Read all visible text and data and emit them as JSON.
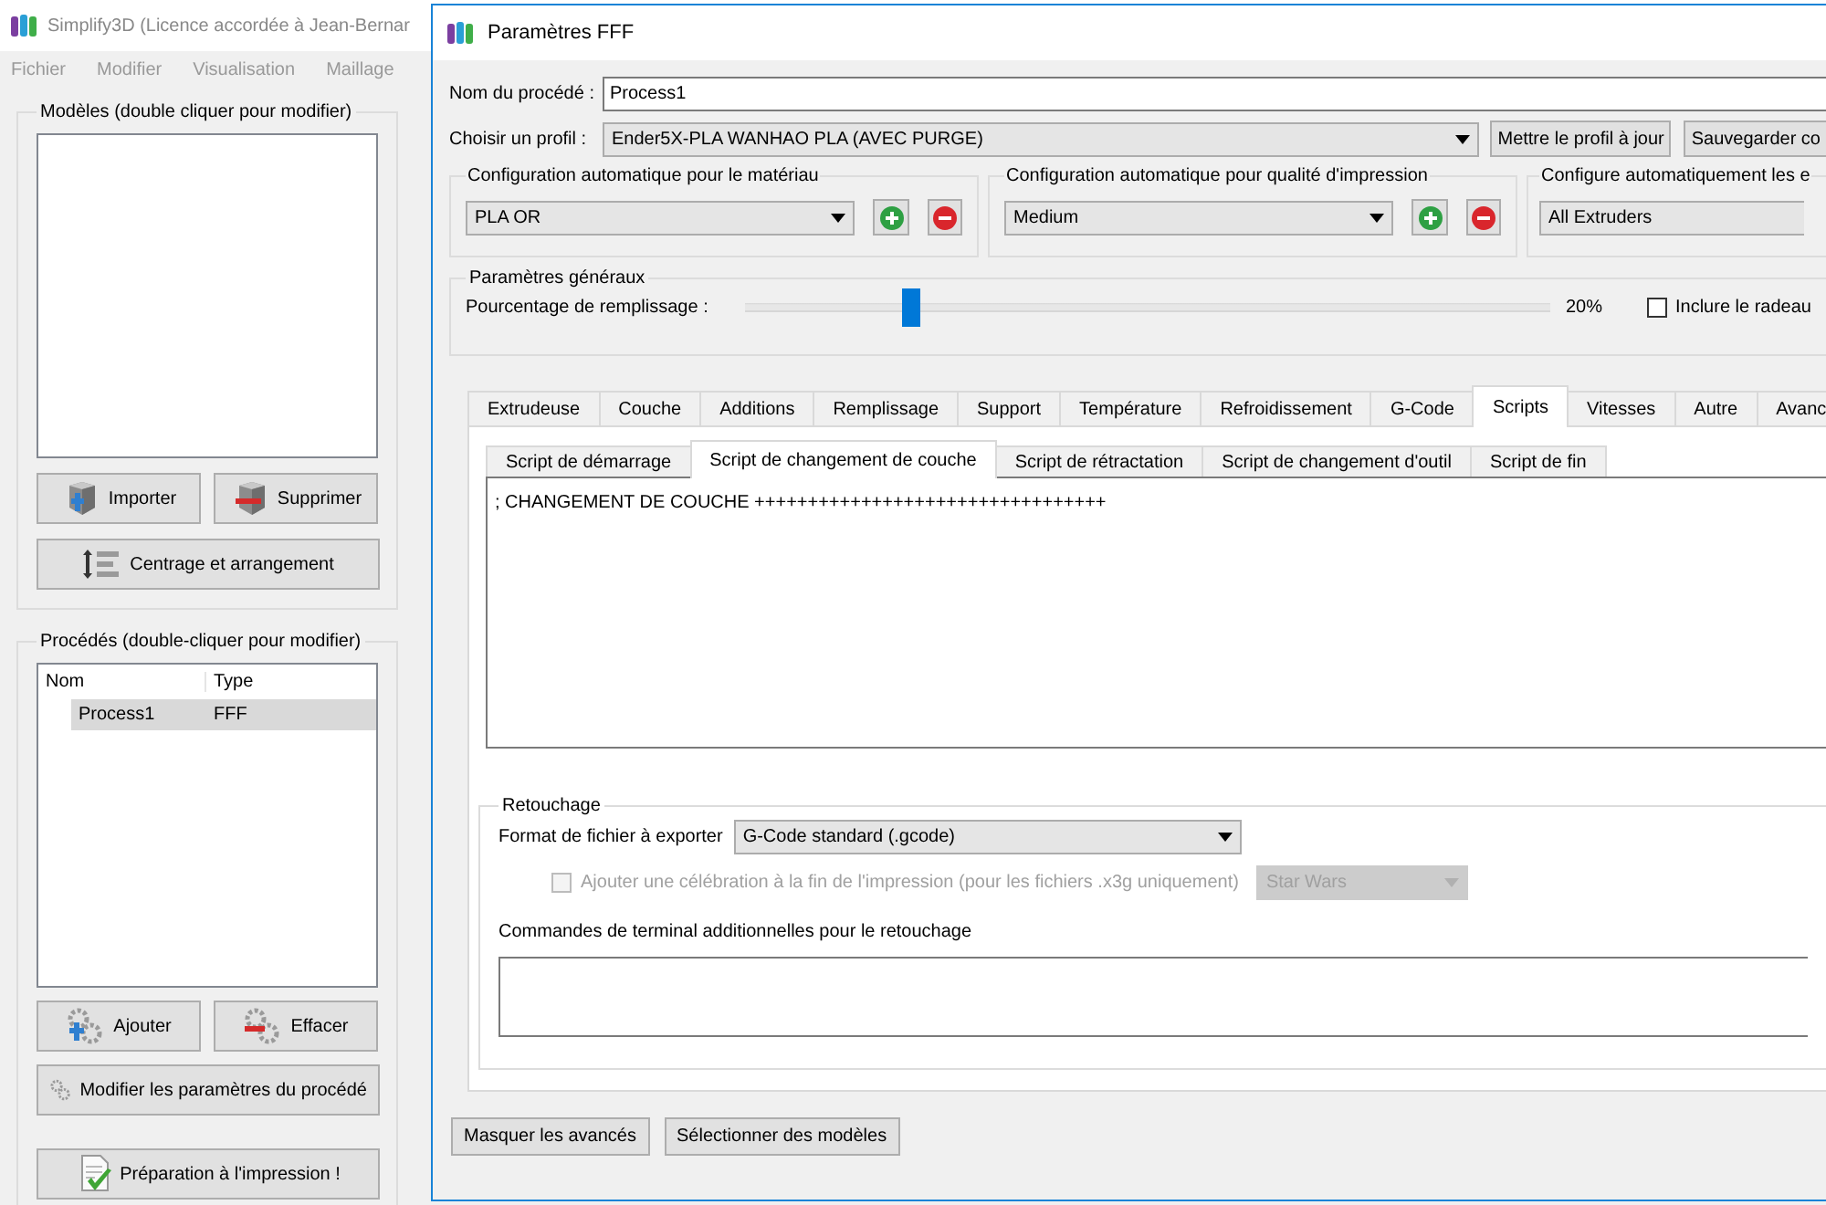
{
  "app": {
    "title": "Simplify3D (Licence accordée à Jean-Bernar",
    "menu": [
      "Fichier",
      "Modifier",
      "Visualisation",
      "Maillage"
    ],
    "models_panel": {
      "title": "Modèles (double cliquer pour modifier)",
      "buttons": [
        {
          "kind": "import",
          "label": "Importer"
        },
        {
          "kind": "delete",
          "label": "Supprimer"
        },
        {
          "kind": "arrange",
          "label": "Centrage et arrangement"
        }
      ]
    },
    "processes_panel": {
      "title": "Procédés (double-cliquer pour modifier)",
      "columns": [
        "Nom",
        "Type"
      ],
      "rows": [
        {
          "name": "Process1",
          "type": "FFF",
          "selected": true
        }
      ],
      "buttons": [
        {
          "kind": "add",
          "label": "Ajouter"
        },
        {
          "kind": "remove",
          "label": "Effacer"
        },
        {
          "kind": "edit",
          "label": "Modifier les paramètres du procédé"
        },
        {
          "kind": "prepare",
          "label": "Préparation à l'impression !"
        }
      ]
    }
  },
  "dialog": {
    "title": "Paramètres FFF",
    "process_name_label": "Nom du procédé :",
    "process_name": "Process1",
    "profile_label": "Choisir un profil :",
    "profile": "Ender5X-PLA WANHAO PLA (AVEC PURGE)",
    "profile_buttons": [
      "Mettre le profil à jour",
      "Sauvegarder co"
    ],
    "auto_configs": [
      {
        "title": "Configuration automatique pour le matériau",
        "value": "PLA OR",
        "add_remove": true
      },
      {
        "title": "Configuration automatique pour qualité d'impression",
        "value": "Medium",
        "add_remove": true
      },
      {
        "title": "Configure automatiquement les e",
        "value": "All Extruders",
        "add_remove": false
      }
    ],
    "general": {
      "title": "Paramètres généraux",
      "infill_label": "Pourcentage de remplissage :",
      "level": 0.2,
      "infill_reading": "20%",
      "raft": {
        "label": "Inclure le radeau",
        "checked": false
      }
    },
    "tabs": [
      {
        "label": "Extrudeuse",
        "selected": false
      },
      {
        "label": "Couche",
        "selected": false
      },
      {
        "label": "Additions",
        "selected": false
      },
      {
        "label": "Remplissage",
        "selected": false
      },
      {
        "label": "Support",
        "selected": false
      },
      {
        "label": "Température",
        "selected": false
      },
      {
        "label": "Refroidissement",
        "selected": false
      },
      {
        "label": "G-Code",
        "selected": false
      },
      {
        "label": "Scripts",
        "selected": true
      },
      {
        "label": "Vitesses",
        "selected": false
      },
      {
        "label": "Autre",
        "selected": false
      },
      {
        "label": "Avanc",
        "selected": false
      }
    ],
    "subtabs": [
      {
        "label": "Script de démarrage",
        "selected": false
      },
      {
        "label": "Script de changement de couche",
        "selected": true
      },
      {
        "label": "Script de rétractation",
        "selected": false
      },
      {
        "label": "Script de changement d'outil",
        "selected": false
      },
      {
        "label": "Script de fin",
        "selected": false
      }
    ],
    "script": "; CHANGEMENT DE COUCHE +++++++++++++++++++++++++++++++++",
    "postprocessing": {
      "title": "Retouchage",
      "export_label": "Format de fichier à exporter",
      "export_format": "G-Code standard (.gcode)",
      "celebration": {
        "label": "Ajouter une célébration à la fin de l'impression (pour les fichiers .x3g uniquement)",
        "checked": false,
        "disabled": true,
        "tune": "Star Wars"
      },
      "commands_label": "Commandes de terminal additionnelles pour le retouchage"
    },
    "footer_buttons": [
      "Masquer les avancés",
      "Sélectionner des modèles"
    ]
  }
}
